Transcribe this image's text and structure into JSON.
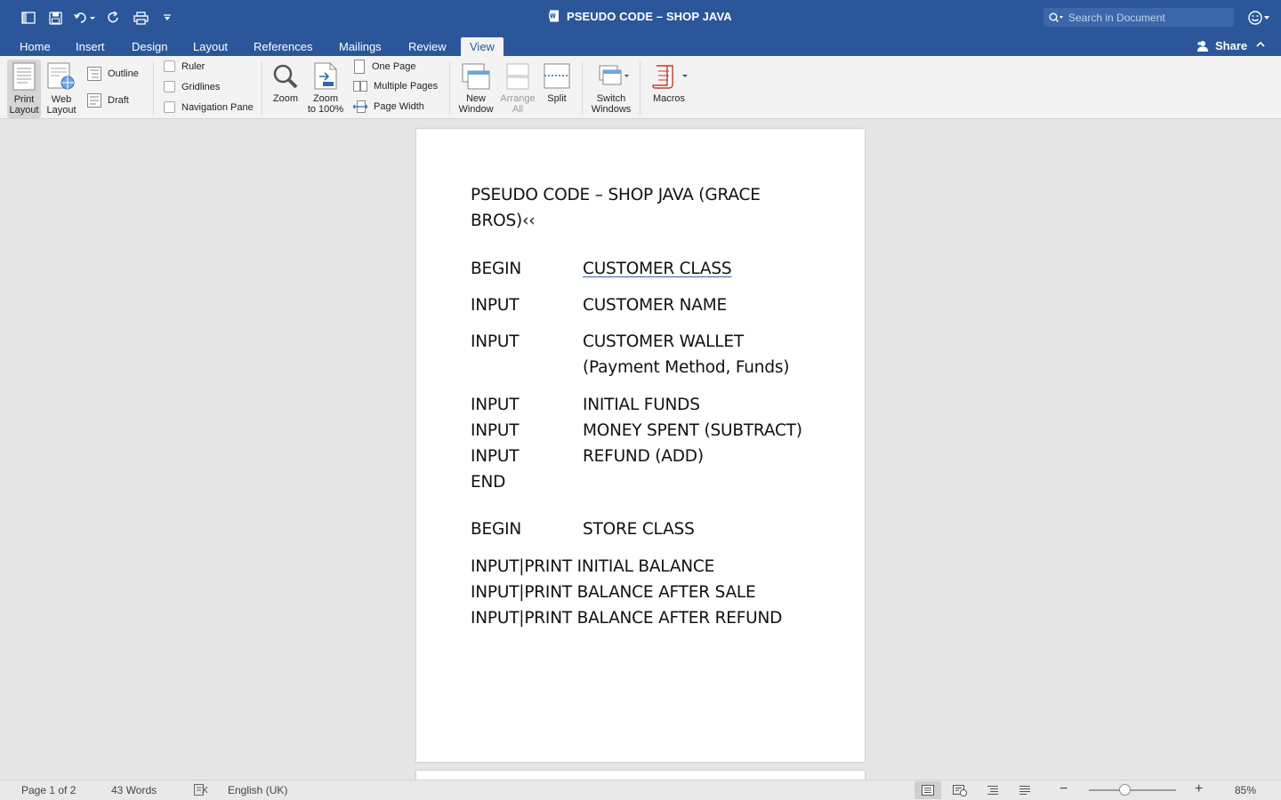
{
  "window": {
    "title": "PSEUDO CODE – SHOP JAVA",
    "search_placeholder": "Search in Document"
  },
  "tabs": [
    "Home",
    "Insert",
    "Design",
    "Layout",
    "References",
    "Mailings",
    "Review",
    "View"
  ],
  "active_tab": "View",
  "share_label": "Share",
  "ribbon": {
    "print_layout": [
      "Print",
      "Layout"
    ],
    "web_layout": [
      "Web",
      "Layout"
    ],
    "outline": "Outline",
    "draft": "Draft",
    "ruler": "Ruler",
    "gridlines": "Gridlines",
    "navigation_pane": "Navigation Pane",
    "zoom": "Zoom",
    "zoom_100": [
      "Zoom",
      "to 100%"
    ],
    "one_page": "One Page",
    "multiple_pages": "Multiple Pages",
    "page_width": "Page Width",
    "new_window": [
      "New",
      "Window"
    ],
    "arrange_all": [
      "Arrange",
      "All"
    ],
    "split": "Split",
    "switch_windows": [
      "Switch",
      "Windows"
    ],
    "macros": "Macros"
  },
  "document": {
    "title_line1": "PSEUDO CODE – SHOP JAVA (GRACE",
    "title_line2": "BROS)‹‹",
    "customer_block": [
      {
        "kw": "BEGIN",
        "text": "CUSTOMER  CLASS"
      },
      {
        "kw": "INPUT",
        "text": "CUSTOMER NAME"
      },
      {
        "kw": "INPUT",
        "text": "CUSTOMER WALLET"
      },
      {
        "kw": "",
        "text": "(Payment Method, Funds)"
      },
      {
        "kw": "INPUT",
        "text": "INITIAL FUNDS"
      },
      {
        "kw": "INPUT",
        "text": "MONEY SPENT (SUBTRACT)"
      },
      {
        "kw": "INPUT",
        "text": "REFUND (ADD)"
      },
      {
        "kw": "END",
        "text": ""
      }
    ],
    "store_begin": {
      "kw": "BEGIN",
      "text": "STORE CLASS"
    },
    "store_lines": [
      "INPUT|PRINT INITIAL BALANCE",
      "INPUT|PRINT BALANCE AFTER SALE",
      "INPUT|PRINT BALANCE AFTER REFUND"
    ]
  },
  "status": {
    "page": "Page 1 of 2",
    "words": "43 Words",
    "language": "English (UK)",
    "zoom": "85%",
    "zoom_fraction": 0.85
  }
}
